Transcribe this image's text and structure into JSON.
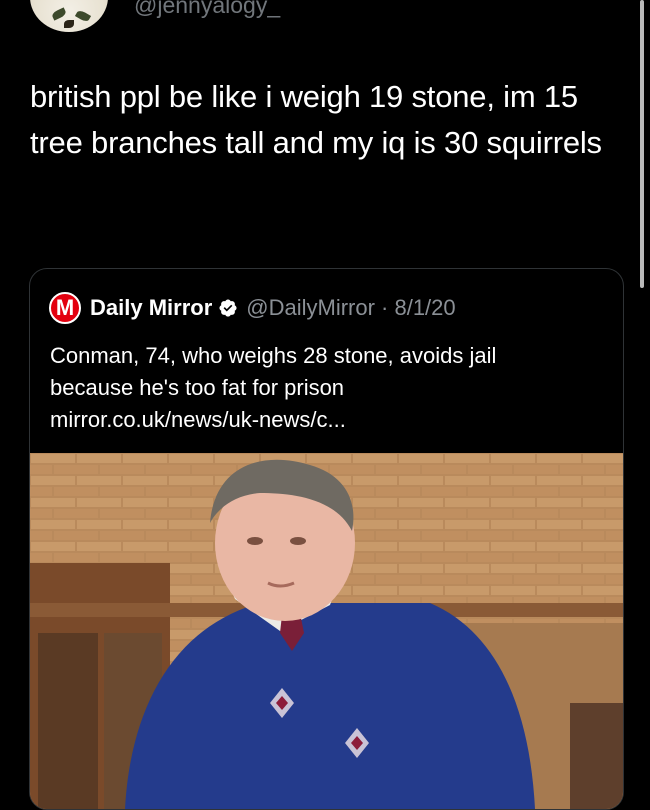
{
  "author": {
    "handle": "@jennyalogy_",
    "avatar_icon": "avatar-image"
  },
  "tweet": {
    "text": "british ppl be like i weigh 19 stone, im 15 tree branches tall and my iq is 30 squirrels"
  },
  "quoted": {
    "logo_letter": "M",
    "name": "Daily Mirror",
    "verified_icon": "verified-badge-icon",
    "meta": "@DailyMirror · 8/1/20",
    "text_line1": "Conman, 74, who weighs 28 stone, avoids jail",
    "text_line2": "because he's too fat for prison",
    "link": "mirror.co.uk/news/uk-news/c...",
    "image": "photo-man-in-blue-sweater"
  },
  "colors": {
    "background": "#000000",
    "text": "#ffffff",
    "muted": "#71767b",
    "mirror_red": "#e3000f",
    "card_border": "#2f3336"
  }
}
